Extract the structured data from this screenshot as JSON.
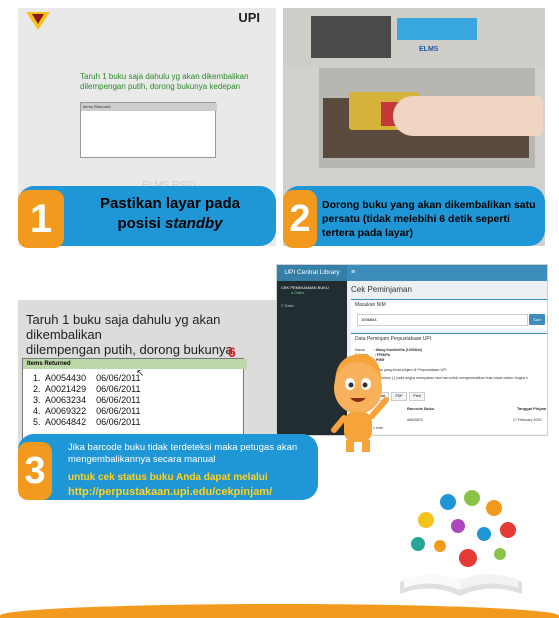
{
  "step1": {
    "number": "1",
    "title_line1": "Pastikan layar pada",
    "title_line2_prefix": "posisi ",
    "title_line2_italic": "standby",
    "screen": {
      "brand": "UPI",
      "message_line1": "Taruh 1 buku saja dahulu yg akan dikembalikan",
      "message_line2": "dilempengan putih, dorong bukunya kedepan",
      "table_header": "Items Returned",
      "footer": "ELMS RSID"
    }
  },
  "step2": {
    "number": "2",
    "text": "Dorong buku yang akan dikembalikan satu persatu (tidak melebihi 6 detik seperti tertera pada layar)",
    "kiosk_label": "ELMS"
  },
  "step3": {
    "number": "3",
    "text": "Jika barcode buku tidak terdeteksi maka petugas akan mengembalikannya secara manual",
    "check_text": "untuk cek status buku Anda dapat melalui",
    "url": "http://perpustakaan.upi.edu/cekpinjam/",
    "screen": {
      "message_line1": "Taruh 1 buku saja dahulu yg akan dikembalikan",
      "message_line2": "dilempengan putih, dorong bukunya kedepan",
      "counter": "6",
      "table_header": "Items Returned",
      "items": [
        {
          "no": "1.",
          "code": "A0054430",
          "date": "06/06/2011"
        },
        {
          "no": "2.",
          "code": "A0021429",
          "date": "06/06/2011"
        },
        {
          "no": "3.",
          "code": "A0063234",
          "date": "06/06/2011"
        },
        {
          "no": "4.",
          "code": "A0069322",
          "date": "06/06/2011"
        },
        {
          "no": "5.",
          "code": "A0064842",
          "date": "06/06/2011"
        }
      ]
    }
  },
  "webapp": {
    "brand": "UPI Central Library",
    "menu_icon": "≡",
    "sidebar_user": "CEK PEMINJAMAN BUKU",
    "sidebar_status": "● Online",
    "sidebar_nav": "≡ Dash",
    "page_title": "Cek Peminjaman",
    "nim_label": "Masukan NIM",
    "nim_value": "1006844",
    "search_button": "Cari",
    "data_title": "Data Peminjam Perpustakaan UPI",
    "fields": [
      {
        "label": "Nama",
        "value": ": Wang Kandielifia (1006844)"
      },
      {
        "label": "Fakultas",
        "value": ": FPMIPA"
      },
      {
        "label": "Jurusan",
        "value": ": PMM"
      }
    ],
    "info": "Berikut data buku yang Anda pinjam di Perpustakaan UPI.",
    "note_label": "Catatan:",
    "note": "Tanda minus (-) pada angka merupakan sisa hari untuk mengembalikan buku tepat waktu. Angka n",
    "buttons": [
      "Copy",
      "Excel",
      "PDF",
      "Print"
    ],
    "table_headers": [
      "No",
      "Barcode Buku",
      "Tanggal Pinjam"
    ],
    "rows": [
      {
        "no": "1",
        "barcode": "a0845870",
        "date": "17 February 2020"
      }
    ],
    "footer_text": "of 1 entri"
  },
  "colors": {
    "bar_blue": "#1f97d6",
    "number_orange": "#f39a1e",
    "link_yellow": "#ffd21e",
    "app_blue": "#3c8dbc"
  }
}
